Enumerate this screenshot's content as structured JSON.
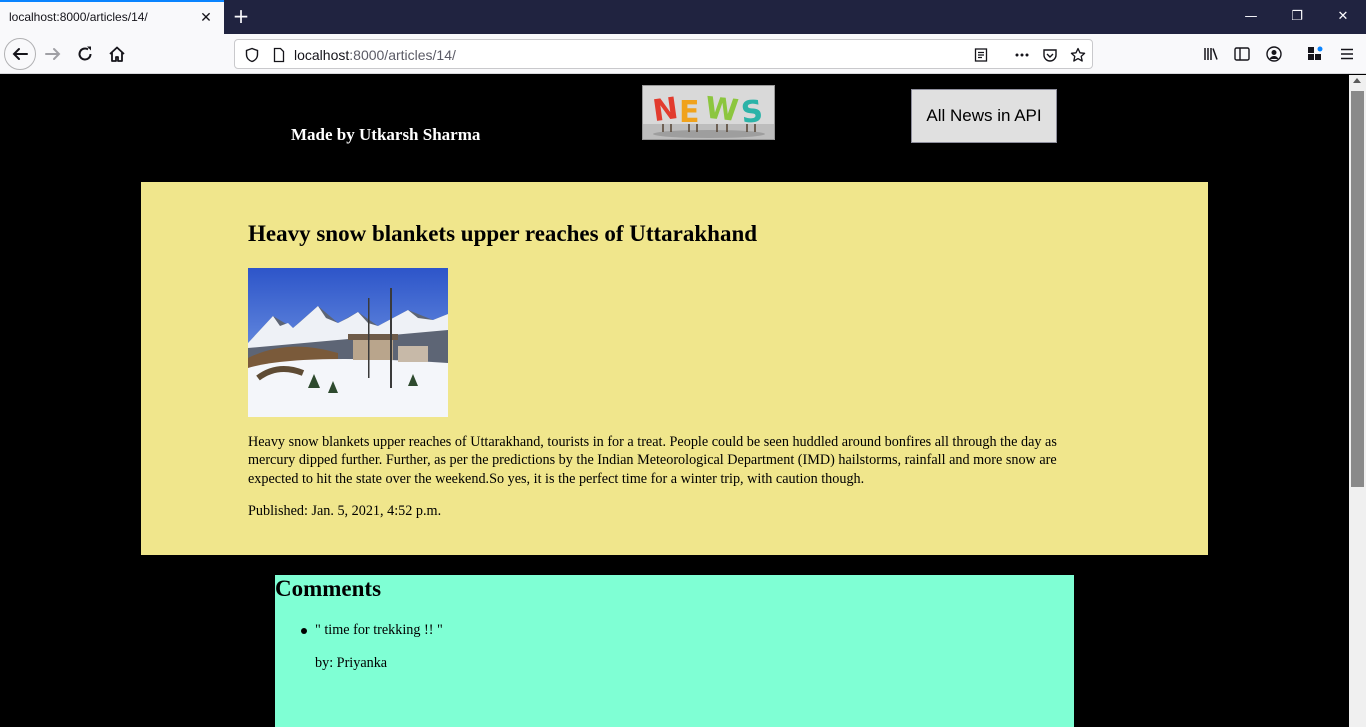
{
  "browser": {
    "tab_title": "localhost:8000/articles/14/",
    "url_host": "localhost",
    "url_path": ":8000/articles/14/",
    "accent_color": "#0a84ff"
  },
  "header": {
    "made_by": "Made by Utkarsh Sharma",
    "logo_text": "NEWS",
    "api_button_label": "All News in API"
  },
  "article": {
    "title": "Heavy snow blankets upper reaches of Uttarakhand",
    "body": "Heavy snow blankets upper reaches of Uttarakhand, tourists in for a treat. People could be seen huddled around bonfires all through the day as mercury dipped further. Further, as per the predictions by the Indian Meteorological Department (IMD) hailstorms, rainfall and more snow are expected to hit the state over the weekend.So yes, it is the perfect time for a winter trip, with caution though.",
    "published": "Published: Jan. 5, 2021, 4:52 p.m.",
    "background_color": "#f0e68c"
  },
  "comments": {
    "heading": "Comments",
    "background_color": "#7fffd4",
    "items": [
      {
        "text": "\" time for trekking !! \"",
        "author": "by: Priyanka"
      }
    ]
  }
}
